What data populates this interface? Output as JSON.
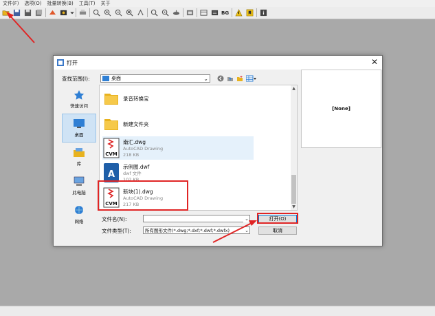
{
  "menu": [
    "文件(F)",
    "选项(O)",
    "批量转换(B)",
    "工具(T)",
    "关于"
  ],
  "toolbar": {
    "bg_label": "BG"
  },
  "dialog": {
    "title": "打开",
    "look_in_label": "查找范围(I):",
    "look_in_value": "桌面",
    "places": [
      "快速访问",
      "桌面",
      "库",
      "此电脑",
      "网络"
    ],
    "files": [
      {
        "name": "录音转换宝",
        "type": "",
        "size": ""
      },
      {
        "name": "新建文件夹",
        "type": "",
        "size": ""
      },
      {
        "name": "南汇.dwg",
        "type": "AutoCAD Drawing",
        "size": "218 KB"
      },
      {
        "name": "示例图.dwf",
        "type": "dwf 文件",
        "size": "102 KB"
      },
      {
        "name": "新块(1).dwg",
        "type": "AutoCAD Drawing",
        "size": "217 KB"
      }
    ],
    "preview_text": "[None]",
    "filename_label": "文件名(N):",
    "filename_value": "",
    "filetype_label": "文件类型(T):",
    "filetype_value": "所有图形文件(*.dwg;*.dxf;*.dwf;*.dwfx)",
    "open_button": "打开(O)",
    "cancel_button": "取消"
  },
  "colors": {
    "accent": "#0078d7",
    "highlight": "#e5f1fb",
    "annotation": "#e02424"
  }
}
